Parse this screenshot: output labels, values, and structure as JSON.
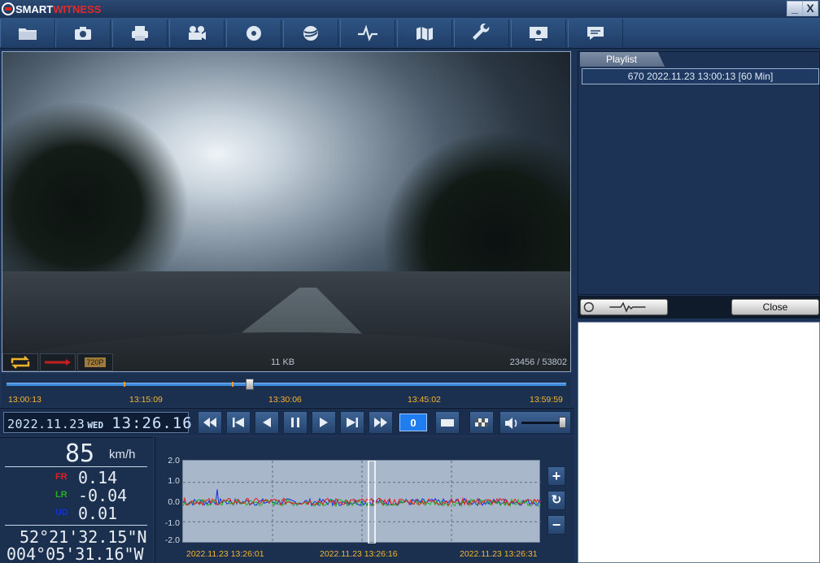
{
  "app": {
    "title_a": "SMART",
    "title_b": "WITNESS",
    "minimize": "_",
    "close": "X"
  },
  "toolbar": [
    "folder-icon",
    "camera-icon",
    "printer-icon",
    "video-export-icon",
    "disc-icon",
    "globe-icon",
    "pulse-icon",
    "map-icon",
    "wrench-icon",
    "screen-settings-icon",
    "chat-icon"
  ],
  "video": {
    "file_size": "11 KB",
    "frames": "23456 / 53802",
    "res_badge": "720P"
  },
  "timeline": {
    "labels": [
      "13:00:13",
      "13:15:09",
      "13:30:06",
      "13:45:02",
      "13:59:59"
    ]
  },
  "clock": {
    "date": "2022.11.23",
    "weekday": "WED",
    "time": "13:26.16"
  },
  "controls": {
    "speed_value": "0"
  },
  "info": {
    "speed": "85",
    "speed_unit": "km/h",
    "fr_label": "FR",
    "fr_value": "0.14",
    "lr_label": "LR",
    "lr_value": "-0.04",
    "ud_label": "UD",
    "ud_value": "0.01",
    "lat": "52°21'32.15\"N",
    "lon": "004°05'31.16\"W"
  },
  "graph": {
    "y_labels": [
      "2.0",
      "1.0",
      "0.0",
      "-1.0",
      "-2.0"
    ],
    "x_labels": [
      "2022.11.23 13:26:01",
      "2022.11.23 13:26:16",
      "2022.11.23 13:26:31"
    ],
    "zoom_in": "+",
    "reset": "↻",
    "zoom_out": "−",
    "colors": {
      "fr": "#e02020",
      "lr": "#20b020",
      "ud": "#1030e0"
    }
  },
  "playlist": {
    "tab": "Playlist",
    "items": [
      {
        "label": "670  2022.11.23 13:00:13 [60 Min]"
      }
    ],
    "close_label": "Close"
  }
}
